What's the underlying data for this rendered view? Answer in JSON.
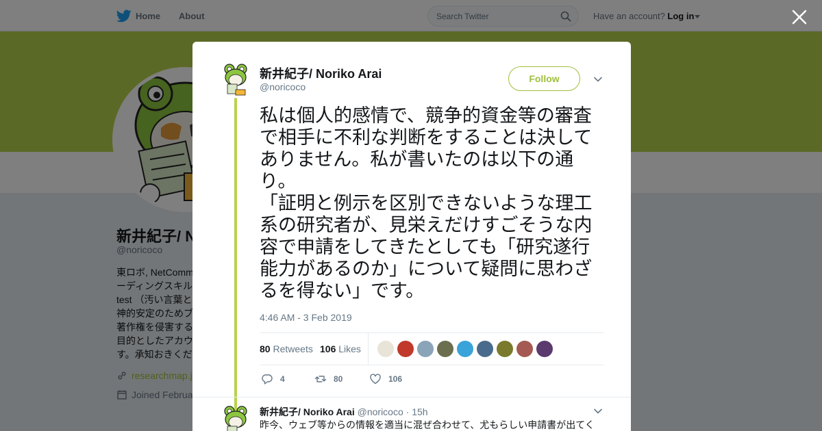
{
  "nav": {
    "home_label": "Home",
    "about_label": "About",
    "search_placeholder": "Search Twitter",
    "account_prompt": "Have an account?",
    "login_label": "Log in"
  },
  "profile": {
    "name": "新井紀子/ N",
    "handle": "@noricoco",
    "bio_lines": [
      "東ロボ, NetComm",
      "ーディングスキル",
      "test （汚い言葉と",
      "神的安定のためブ",
      "著作権を侵害する",
      "目的としたアカウ",
      "す。承知おきくだ"
    ],
    "link": "researchmap.j",
    "joined": "Joined Februa"
  },
  "tweet": {
    "author_name": "新井紀子/ Noriko Arai",
    "author_handle": "@noricoco",
    "follow_label": "Follow",
    "text_paragraphs": [
      "私は個人的感情で、競争的資金等の審査で相手に不利な判断をすることは決してありません。私が書いたのは以下の通り。",
      "「証明と例示を区別できないような理工系の研究者が、見栄えだけすごそうな内容で申請をしてきたとしても「研究遂行能力があるのか」について疑問に思わざるを得ない」です。"
    ],
    "timestamp": "4:46 AM - 3 Feb 2019",
    "retweets_count": "80",
    "retweets_label": "Retweets",
    "likes_count": "106",
    "likes_label": "Likes",
    "likers": [
      {
        "name": "liker-1",
        "color": "#e9e4d8"
      },
      {
        "name": "liker-2",
        "color": "#c0392b"
      },
      {
        "name": "liker-3",
        "color": "#8aa4b8"
      },
      {
        "name": "liker-4",
        "color": "#6b6f4e"
      },
      {
        "name": "liker-5",
        "color": "#3aa3d9"
      },
      {
        "name": "liker-6",
        "color": "#4a6c8c"
      },
      {
        "name": "liker-7",
        "color": "#7a7a2c"
      },
      {
        "name": "liker-8",
        "color": "#a45a52"
      },
      {
        "name": "liker-9",
        "color": "#5b3a6e"
      }
    ],
    "reply_count": "4",
    "retweet_count": "80",
    "like_count": "106"
  },
  "reply": {
    "author_name": "新井紀子/ Noriko Arai",
    "author_handle": "@noricoco",
    "time": "· 15h",
    "text": "昨今、ウェブ等からの情報を適当に混ぜ合わせて、尤もらしい申請書が出てく"
  },
  "colors": {
    "accent": "#9fbf3b",
    "banner": "#b7d34c",
    "twitter_blue": "#1da1f2",
    "overlay": "rgba(0,0,0,0.5)"
  },
  "icons": [
    "twitter-bird-icon",
    "search-icon",
    "close-icon",
    "chevron-down-icon",
    "link-icon",
    "calendar-icon",
    "reply-icon",
    "retweet-icon",
    "heart-icon"
  ]
}
